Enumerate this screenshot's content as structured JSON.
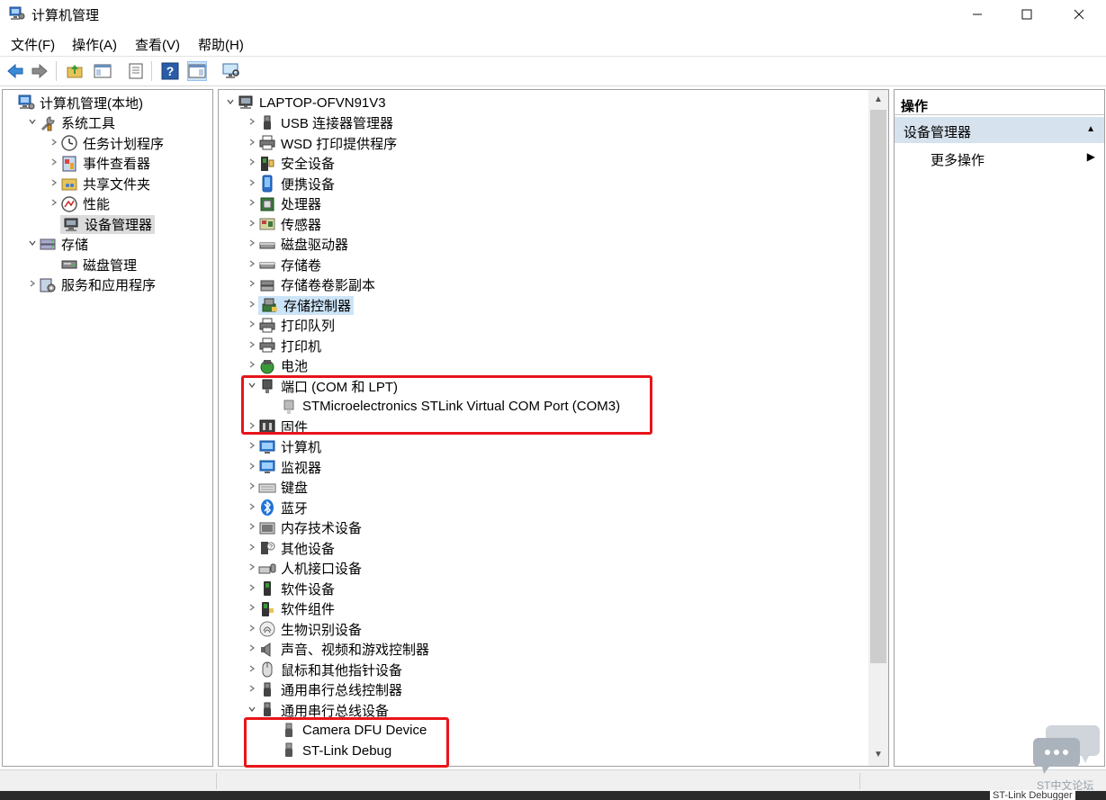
{
  "window": {
    "title": "计算机管理"
  },
  "menu": [
    "文件(F)",
    "操作(A)",
    "查看(V)",
    "帮助(H)"
  ],
  "left_tree": [
    {
      "label": "计算机管理(本地)",
      "caret": "",
      "icon": "computer-mgmt-icon",
      "indent": 0
    },
    {
      "label": "系统工具",
      "caret": "down",
      "icon": "tools-icon",
      "indent": 1
    },
    {
      "label": "任务计划程序",
      "caret": "right",
      "icon": "clock-icon",
      "indent": 2
    },
    {
      "label": "事件查看器",
      "caret": "right",
      "icon": "event-viewer-icon",
      "indent": 2
    },
    {
      "label": "共享文件夹",
      "caret": "right",
      "icon": "shared-folder-icon",
      "indent": 2
    },
    {
      "label": "性能",
      "caret": "right",
      "icon": "performance-icon",
      "indent": 2
    },
    {
      "label": "设备管理器",
      "caret": "",
      "icon": "device-manager-icon",
      "indent": 2,
      "selected": true
    },
    {
      "label": "存储",
      "caret": "down",
      "icon": "storage-icon",
      "indent": 1
    },
    {
      "label": "磁盘管理",
      "caret": "",
      "icon": "disk-mgmt-icon",
      "indent": 2
    },
    {
      "label": "服务和应用程序",
      "caret": "right",
      "icon": "services-icon",
      "indent": 1
    }
  ],
  "device_tree": [
    {
      "label": "LAPTOP-OFVN91V3",
      "caret": "down",
      "icon": "computer-root-icon",
      "indent": 0
    },
    {
      "label": "USB 连接器管理器",
      "caret": "right",
      "icon": "usb-icon",
      "indent": 1
    },
    {
      "label": "WSD 打印提供程序",
      "caret": "right",
      "icon": "printer-icon",
      "indent": 1
    },
    {
      "label": "安全设备",
      "caret": "right",
      "icon": "security-device-icon",
      "indent": 1
    },
    {
      "label": "便携设备",
      "caret": "right",
      "icon": "portable-device-icon",
      "indent": 1
    },
    {
      "label": "处理器",
      "caret": "right",
      "icon": "processor-icon",
      "indent": 1
    },
    {
      "label": "传感器",
      "caret": "right",
      "icon": "sensor-icon",
      "indent": 1
    },
    {
      "label": "磁盘驱动器",
      "caret": "right",
      "icon": "disk-drive-icon",
      "indent": 1
    },
    {
      "label": "存储卷",
      "caret": "right",
      "icon": "storage-volume-icon",
      "indent": 1
    },
    {
      "label": "存储卷卷影副本",
      "caret": "right",
      "icon": "shadow-copy-icon",
      "indent": 1
    },
    {
      "label": "存储控制器",
      "caret": "right",
      "icon": "storage-controller-icon",
      "indent": 1,
      "highlighted": true
    },
    {
      "label": "打印队列",
      "caret": "right",
      "icon": "print-queue-icon",
      "indent": 1
    },
    {
      "label": "打印机",
      "caret": "right",
      "icon": "printer-icon",
      "indent": 1
    },
    {
      "label": "电池",
      "caret": "right",
      "icon": "battery-icon",
      "indent": 1
    },
    {
      "label": "端口 (COM 和 LPT)",
      "caret": "down",
      "icon": "port-icon",
      "indent": 1
    },
    {
      "label": "STMicroelectronics STLink Virtual COM Port (COM3)",
      "caret": "",
      "icon": "com-port-icon",
      "indent": 2
    },
    {
      "label": "固件",
      "caret": "right",
      "icon": "firmware-icon",
      "indent": 1
    },
    {
      "label": "计算机",
      "caret": "right",
      "icon": "computer-icon",
      "indent": 1
    },
    {
      "label": "监视器",
      "caret": "right",
      "icon": "monitor-icon",
      "indent": 1
    },
    {
      "label": "键盘",
      "caret": "right",
      "icon": "keyboard-icon",
      "indent": 1
    },
    {
      "label": "蓝牙",
      "caret": "right",
      "icon": "bluetooth-icon",
      "indent": 1
    },
    {
      "label": "内存技术设备",
      "caret": "right",
      "icon": "memory-device-icon",
      "indent": 1
    },
    {
      "label": "其他设备",
      "caret": "right",
      "icon": "other-device-icon",
      "indent": 1
    },
    {
      "label": "人机接口设备",
      "caret": "right",
      "icon": "hid-icon",
      "indent": 1
    },
    {
      "label": "软件设备",
      "caret": "right",
      "icon": "software-device-icon",
      "indent": 1
    },
    {
      "label": "软件组件",
      "caret": "right",
      "icon": "software-component-icon",
      "indent": 1
    },
    {
      "label": "生物识别设备",
      "caret": "right",
      "icon": "biometric-icon",
      "indent": 1
    },
    {
      "label": "声音、视频和游戏控制器",
      "caret": "right",
      "icon": "audio-icon",
      "indent": 1
    },
    {
      "label": "鼠标和其他指针设备",
      "caret": "right",
      "icon": "mouse-icon",
      "indent": 1
    },
    {
      "label": "通用串行总线控制器",
      "caret": "right",
      "icon": "usb-controller-icon",
      "indent": 1
    },
    {
      "label": "通用串行总线设备",
      "caret": "down",
      "icon": "usb-device-icon",
      "indent": 1
    },
    {
      "label": "Camera DFU Device",
      "caret": "",
      "icon": "usb-plug-icon",
      "indent": 2
    },
    {
      "label": "ST-Link Debug",
      "caret": "",
      "icon": "usb-plug-icon",
      "indent": 2
    }
  ],
  "actions": {
    "header": "操作",
    "section": "设备管理器",
    "more": "更多操作"
  },
  "watermark": {
    "text": "ST中文论坛",
    "taskbar_label": "ST-Link Debugger"
  }
}
